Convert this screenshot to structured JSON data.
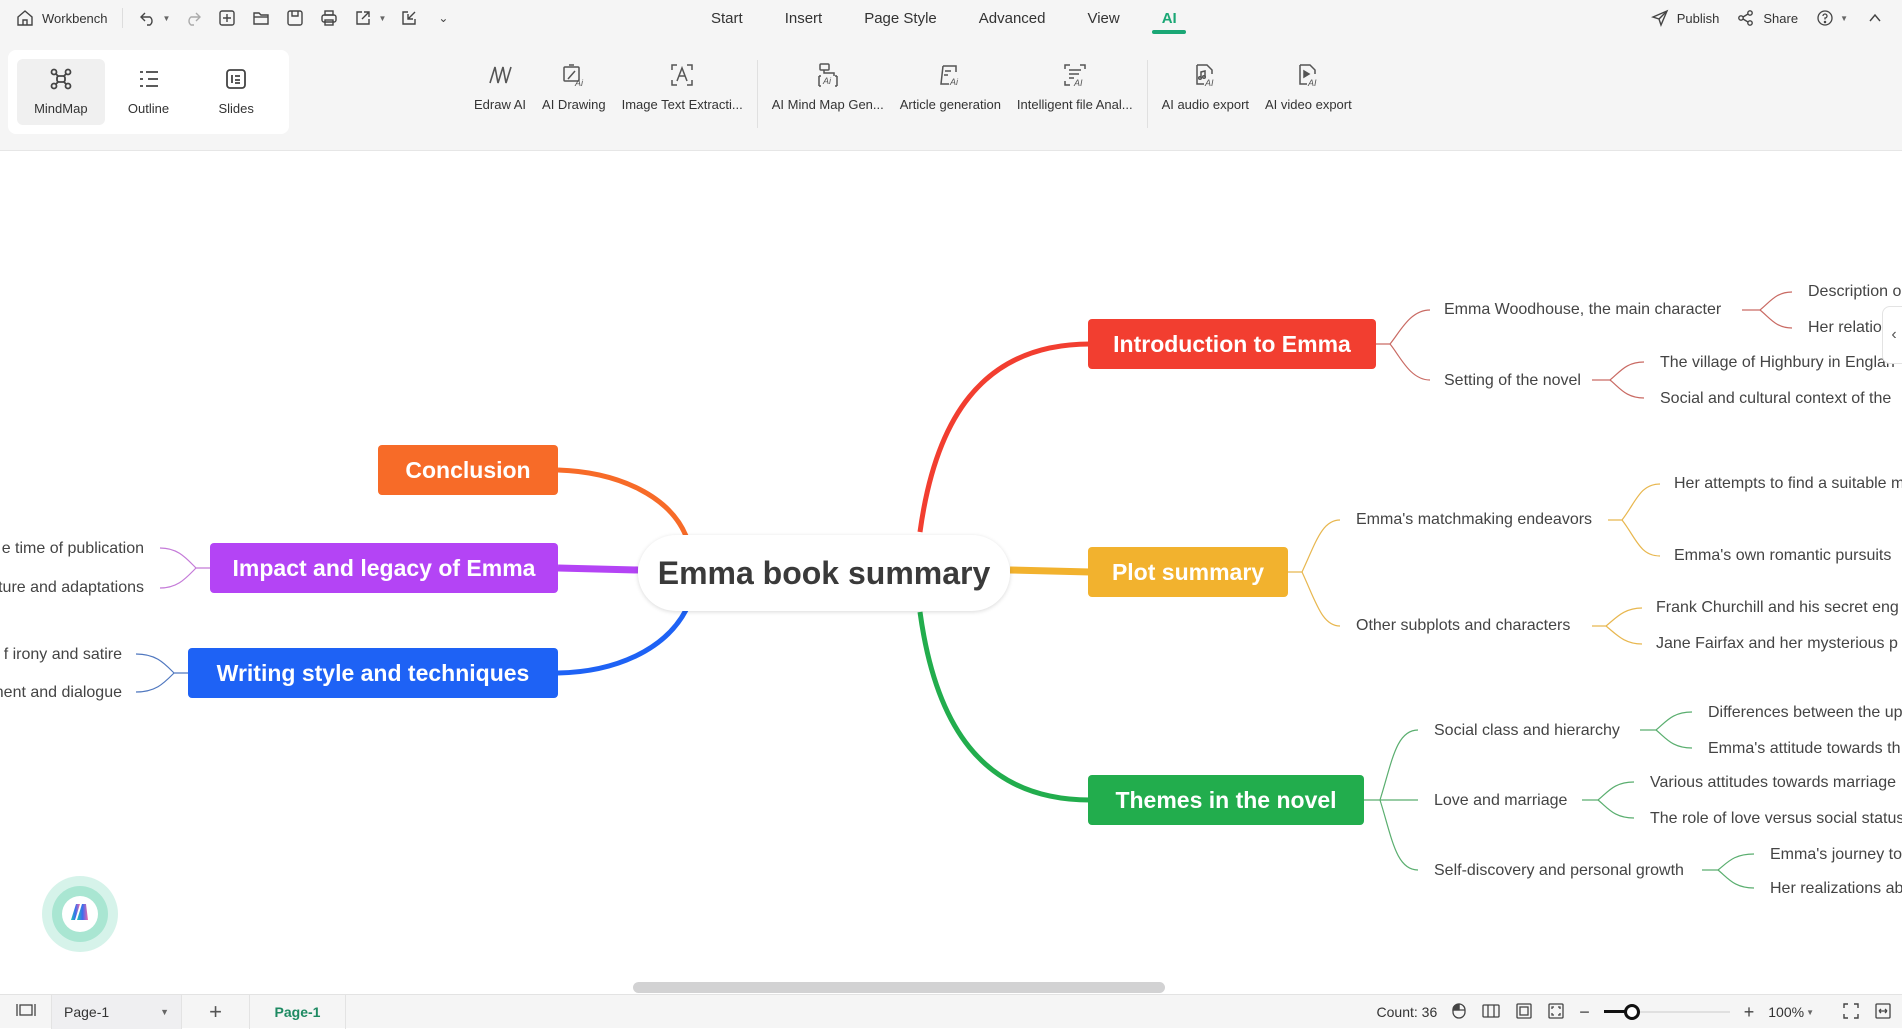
{
  "topbar": {
    "workbench_label": "Workbench",
    "menu_tabs": [
      "Start",
      "Insert",
      "Page Style",
      "Advanced",
      "View",
      "AI"
    ],
    "active_tab": "AI",
    "publish_label": "Publish",
    "share_label": "Share"
  },
  "ribbon": {
    "views": [
      {
        "label": "MindMap",
        "icon": "mindmap-icon",
        "active": true
      },
      {
        "label": "Outline",
        "icon": "outline-icon",
        "active": false
      },
      {
        "label": "Slides",
        "icon": "slides-icon",
        "active": false
      }
    ],
    "ai_tools": [
      {
        "label": "Edraw AI",
        "icon": "edraw-ai-icon"
      },
      {
        "label": "AI Drawing",
        "icon": "ai-drawing-icon"
      },
      {
        "label": "Image Text Extracti...",
        "icon": "image-text-extraction-icon"
      },
      {
        "label": "AI Mind Map Gen...",
        "icon": "ai-mindmap-gen-icon"
      },
      {
        "label": "Article generation",
        "icon": "article-generation-icon"
      },
      {
        "label": "Intelligent file Anal...",
        "icon": "file-analysis-icon"
      },
      {
        "label": "AI audio export",
        "icon": "ai-audio-export-icon"
      },
      {
        "label": "AI video export",
        "icon": "ai-video-export-icon"
      }
    ]
  },
  "mindmap": {
    "root": "Emma book summary",
    "colors": {
      "intro": "#f23e30",
      "plot": "#f2b22e",
      "themes": "#22ad4d",
      "conclusion": "#f76b28",
      "impact": "#b444f5",
      "writing": "#1e62f5"
    },
    "intro": {
      "title": "Introduction to Emma",
      "children": [
        {
          "label": "Emma Woodhouse, the main character",
          "children": [
            "Description o",
            "Her relations"
          ]
        },
        {
          "label": "Setting of the novel",
          "children": [
            "The village of Highbury in Englan",
            "Social and cultural context of the"
          ]
        }
      ]
    },
    "plot": {
      "title": "Plot summary",
      "children": [
        {
          "label": "Emma's matchmaking endeavors",
          "children": [
            "Her attempts to find a suitable m",
            "Emma's own romantic pursuits"
          ]
        },
        {
          "label": "Other subplots and characters",
          "children": [
            "Frank Churchill and his secret eng",
            "Jane Fairfax and her mysterious p"
          ]
        }
      ]
    },
    "themes": {
      "title": "Themes in the novel",
      "children": [
        {
          "label": "Social class and hierarchy",
          "children": [
            "Differences between the up",
            "Emma's attitude towards th"
          ]
        },
        {
          "label": "Love and marriage",
          "children": [
            "Various attitudes towards marriage",
            "The role of love versus social status"
          ]
        },
        {
          "label": "Self-discovery and personal growth",
          "children": [
            "Emma's journey to",
            "Her realizations ab"
          ]
        }
      ]
    },
    "conclusion": {
      "title": "Conclusion"
    },
    "impact": {
      "title": "Impact and legacy of Emma",
      "children": [
        "e time of publication",
        "ture and adaptations"
      ]
    },
    "writing": {
      "title": "Writing style and techniques",
      "children": [
        "f irony and satire",
        "nent and dialogue"
      ]
    }
  },
  "statusbar": {
    "page_select": "Page-1",
    "page_tab": "Page-1",
    "count_label": "Count: 36",
    "zoom_level": "100%",
    "zoom_fraction": 0.22
  }
}
